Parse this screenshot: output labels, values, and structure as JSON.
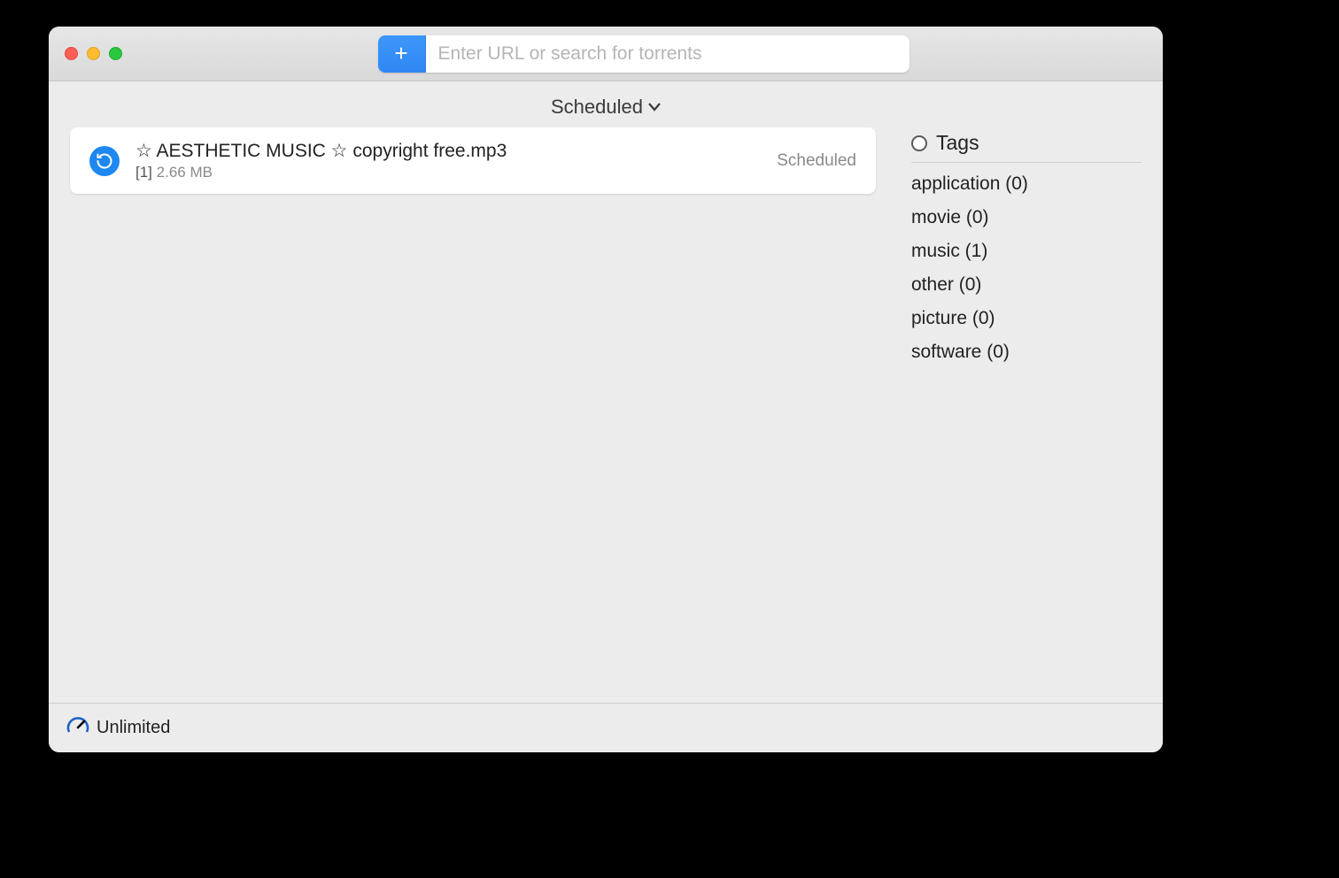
{
  "toolbar": {
    "search_placeholder": "Enter URL or search for torrents"
  },
  "filter": {
    "label": "Scheduled"
  },
  "items": [
    {
      "title": "☆ AESTHETIC MUSIC ☆ copyright free.mp3",
      "index": "[1]",
      "size": "2.66 MB",
      "status": "Scheduled"
    }
  ],
  "tags": {
    "header": "Tags",
    "list": [
      {
        "label": "application (0)"
      },
      {
        "label": "movie (0)"
      },
      {
        "label": "music (1)"
      },
      {
        "label": "other (0)"
      },
      {
        "label": "picture (0)"
      },
      {
        "label": "software (0)"
      }
    ]
  },
  "footer": {
    "speed_label": "Unlimited"
  }
}
